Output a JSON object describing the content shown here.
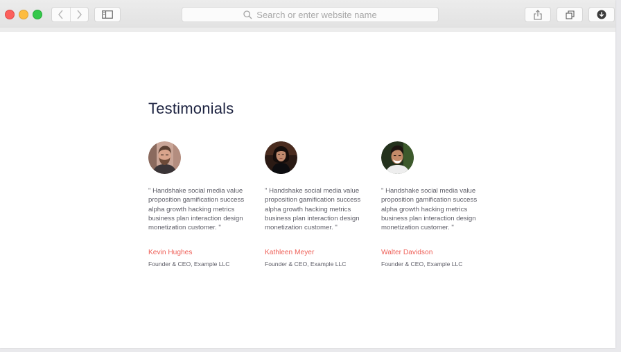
{
  "browser": {
    "address_placeholder": "Search or enter website name",
    "icons": [
      "close-light",
      "minimize-light",
      "zoom-light",
      "back-icon",
      "forward-icon",
      "sidebar-icon",
      "search-icon",
      "share-icon",
      "tabs-icon",
      "download-icon"
    ],
    "colors": {
      "close": "#fc605c",
      "minimize": "#fdbc40",
      "zoom": "#34c84a"
    }
  },
  "page": {
    "heading": "Testimonials",
    "accent_color": "#ee5e56",
    "testimonials": [
      {
        "quote": "\" Handshake social media value proposition gamification success alpha growth hacking metrics business plan interaction design monetization customer. \"",
        "name": "Kevin Hughes",
        "role": "Founder & CEO, Example LLC",
        "avatar": "photo-man-beard"
      },
      {
        "quote": "\" Handshake social media value proposition gamification success alpha growth hacking metrics business plan interaction design monetization customer. \"",
        "name": "Kathleen Meyer",
        "role": "Founder & CEO, Example LLC",
        "avatar": "photo-woman-dark-hair"
      },
      {
        "quote": "\" Handshake social media value proposition gamification success alpha growth hacking metrics business plan interaction design monetization customer. \"",
        "name": "Walter Davidson",
        "role": "Founder & CEO, Example LLC",
        "avatar": "photo-man-smiling"
      }
    ]
  }
}
